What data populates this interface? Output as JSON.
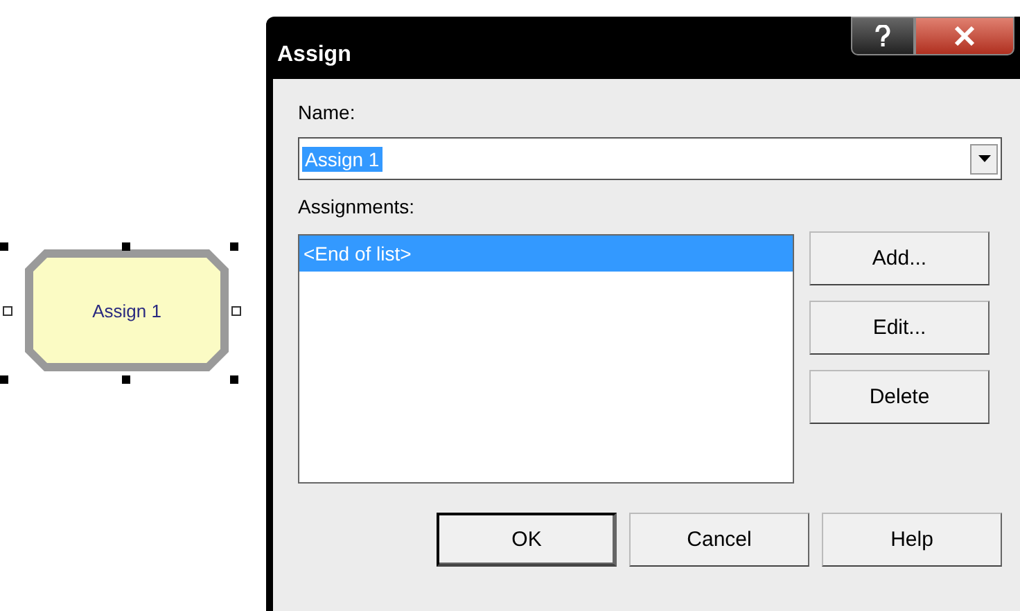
{
  "canvas": {
    "module": {
      "label": "Assign 1",
      "selected": true
    }
  },
  "dialog": {
    "title": "Assign",
    "name_label": "Name:",
    "name_value": "Assign 1",
    "name_highlighted": true,
    "assignments_label": "Assignments:",
    "assignments": [
      {
        "text": "<End of list>",
        "selected": true
      }
    ],
    "side_buttons": [
      "Add...",
      "Edit...",
      "Delete"
    ],
    "buttons": [
      {
        "label": "OK",
        "default": true
      },
      {
        "label": "Cancel",
        "default": false
      },
      {
        "label": "Help",
        "default": false
      }
    ]
  }
}
